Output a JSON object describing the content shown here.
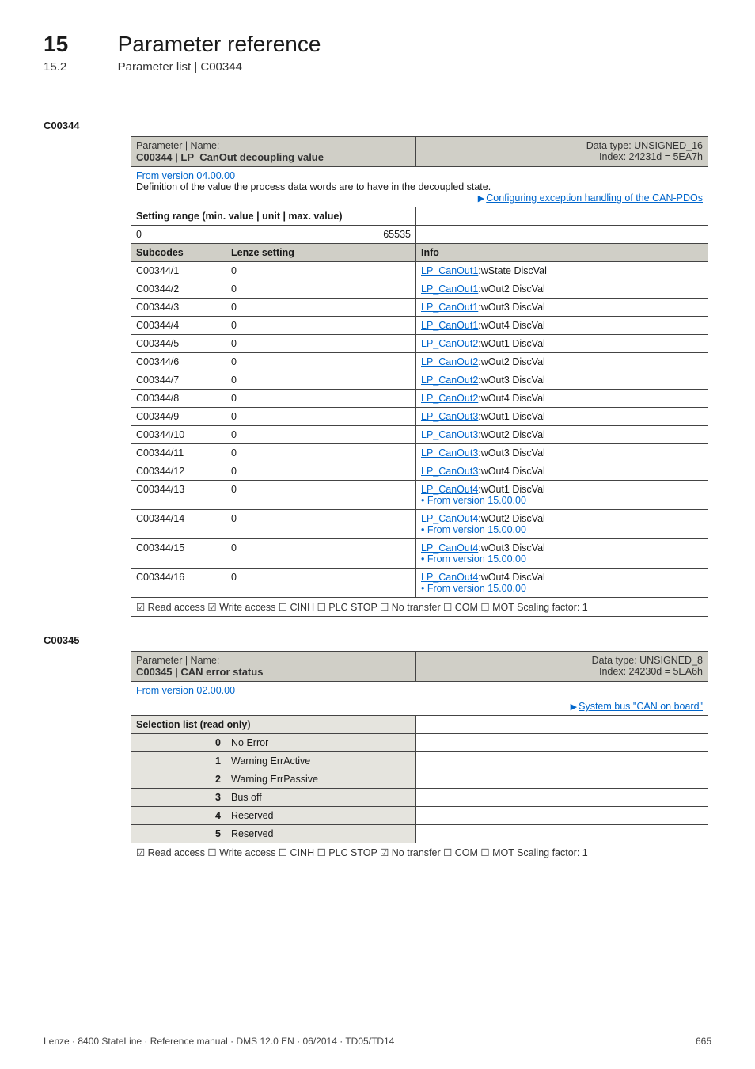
{
  "chapter": {
    "num": "15",
    "title": "Parameter reference"
  },
  "section": {
    "num": "15.2",
    "title": "Parameter list | C00344"
  },
  "anchor1": "C00344",
  "tbl1": {
    "hdrL1": "Parameter | Name:",
    "hdrL2": "C00344 | LP_CanOut decoupling value",
    "hdrR1": "Data type: UNSIGNED_16",
    "hdrR2": "Index: 24231d = 5EA7h",
    "fromVer": "From version 04.00.00",
    "def": "Definition of the value the process data words are to have in the decoupled state.",
    "cfgLink": "Configuring exception handling of the CAN-PDOs",
    "setRange": "Setting range (min. value | unit | max. value)",
    "min": "0",
    "max": "65535",
    "colSub": "Subcodes",
    "colLen": "Lenze setting",
    "colInfo": "Info",
    "rows": [
      {
        "s": "C00344/1",
        "v": "0",
        "i": "LP_CanOut1",
        "p": ":wState DiscVal"
      },
      {
        "s": "C00344/2",
        "v": "0",
        "i": "LP_CanOut1",
        "p": ":wOut2 DiscVal"
      },
      {
        "s": "C00344/3",
        "v": "0",
        "i": "LP_CanOut1",
        "p": ":wOut3 DiscVal"
      },
      {
        "s": "C00344/4",
        "v": "0",
        "i": "LP_CanOut1",
        "p": ":wOut4 DiscVal"
      },
      {
        "s": "C00344/5",
        "v": "0",
        "i": "LP_CanOut2",
        "p": ":wOut1 DiscVal"
      },
      {
        "s": "C00344/6",
        "v": "0",
        "i": "LP_CanOut2",
        "p": ":wOut2 DiscVal"
      },
      {
        "s": "C00344/7",
        "v": "0",
        "i": "LP_CanOut2",
        "p": ":wOut3 DiscVal"
      },
      {
        "s": "C00344/8",
        "v": "0",
        "i": "LP_CanOut2",
        "p": ":wOut4 DiscVal"
      },
      {
        "s": "C00344/9",
        "v": "0",
        "i": "LP_CanOut3",
        "p": ":wOut1 DiscVal"
      },
      {
        "s": "C00344/10",
        "v": "0",
        "i": "LP_CanOut3",
        "p": ":wOut2 DiscVal"
      },
      {
        "s": "C00344/11",
        "v": "0",
        "i": "LP_CanOut3",
        "p": ":wOut3 DiscVal"
      },
      {
        "s": "C00344/12",
        "v": "0",
        "i": "LP_CanOut3",
        "p": ":wOut4 DiscVal"
      },
      {
        "s": "C00344/13",
        "v": "0",
        "i": "LP_CanOut4",
        "p": ":wOut1 DiscVal",
        "extra": "• From version 15.00.00"
      },
      {
        "s": "C00344/14",
        "v": "0",
        "i": "LP_CanOut4",
        "p": ":wOut2 DiscVal",
        "extra": "• From version 15.00.00"
      },
      {
        "s": "C00344/15",
        "v": "0",
        "i": "LP_CanOut4",
        "p": ":wOut3 DiscVal",
        "extra": "• From version 15.00.00"
      },
      {
        "s": "C00344/16",
        "v": "0",
        "i": "LP_CanOut4",
        "p": ":wOut4 DiscVal",
        "extra": "• From version 15.00.00"
      }
    ],
    "footer": "☑ Read access   ☑ Write access   ☐ CINH   ☐ PLC STOP   ☐ No transfer   ☐ COM   ☐ MOT    Scaling factor: 1"
  },
  "anchor2": "C00345",
  "tbl2": {
    "hdrL1": "Parameter | Name:",
    "hdrL2": "C00345 | CAN error status",
    "hdrR1": "Data type: UNSIGNED_8",
    "hdrR2": "Index: 24230d = 5EA6h",
    "fromVer": "From version 02.00.00",
    "sysLink": "System bus \"CAN on board\"",
    "selList": "Selection list (read only)",
    "rows": [
      {
        "n": "0",
        "t": "No Error"
      },
      {
        "n": "1",
        "t": "Warning ErrActive"
      },
      {
        "n": "2",
        "t": "Warning ErrPassive"
      },
      {
        "n": "3",
        "t": "Bus off"
      },
      {
        "n": "4",
        "t": "Reserved"
      },
      {
        "n": "5",
        "t": "Reserved"
      }
    ],
    "footer": "☑ Read access   ☐ Write access   ☐ CINH   ☐ PLC STOP   ☑ No transfer   ☐ COM   ☐ MOT    Scaling factor: 1"
  },
  "footer": {
    "left": "Lenze · 8400 StateLine · Reference manual · DMS 12.0 EN · 06/2014 · TD05/TD14",
    "right": "665"
  }
}
